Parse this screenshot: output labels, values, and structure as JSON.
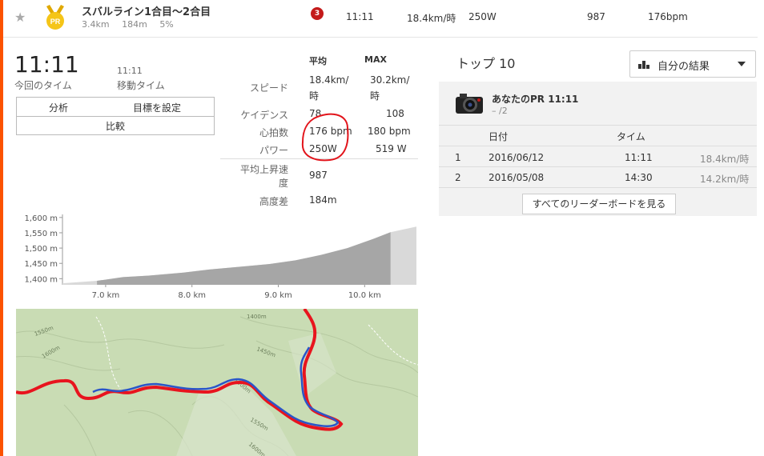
{
  "segment": {
    "title": "スバルライン1合目～2合目",
    "distance": "3.4km",
    "elevation": "184m",
    "grade": "5%",
    "medal_text": "PR",
    "rank_badge": "3",
    "time": "11:11",
    "speed": "18.4km/時",
    "power": "250W",
    "vam": "987",
    "heartrate": "176bpm"
  },
  "summary": {
    "elapsed_time": "11:11",
    "elapsed_label": "今回のタイム",
    "moving_time": "11:11",
    "moving_label": "移動タイム"
  },
  "buttons": {
    "analysis": "分析",
    "set_goal": "目標を設定",
    "compare": "比較"
  },
  "stats": {
    "col_avg": "平均",
    "col_max": "MAX",
    "speed_label": "スピード",
    "speed_avg_1": "18.4km/",
    "speed_avg_2": "時",
    "speed_max_1": "30.2km/",
    "speed_max_2": "時",
    "cadence_label": "ケイデンス",
    "cadence_avg": "78",
    "cadence_max": "108",
    "hr_label": "心拍数",
    "hr_avg": "176 bpm",
    "hr_max": "180 bpm",
    "power_label": "パワー",
    "power_avg": "250W",
    "power_max": "519 W",
    "vam_label_1": "平均上昇速",
    "vam_label_2": "度",
    "vam_value": "987",
    "elev_label": "高度差",
    "elev_value": "184m"
  },
  "chart_data": {
    "type": "area",
    "y_ticks": [
      "1,600 m",
      "1,550 m",
      "1,500 m",
      "1,450 m",
      "1,400 m"
    ],
    "x_ticks": [
      "7.0 km",
      "8.0 km",
      "9.0 km",
      "10.0 km"
    ],
    "x": [
      6.5,
      6.9,
      7.2,
      7.5,
      7.9,
      8.2,
      8.6,
      8.9,
      9.2,
      9.5,
      9.8,
      10.1,
      10.3,
      10.6
    ],
    "y": [
      1385,
      1393,
      1405,
      1410,
      1420,
      1430,
      1440,
      1448,
      1460,
      1478,
      1500,
      1530,
      1552,
      1570
    ],
    "segment_range": [
      6.9,
      10.3
    ],
    "xlim": [
      6.5,
      10.6
    ],
    "ylim": [
      1380,
      1610
    ]
  },
  "map": {
    "contour_labels": [
      "1550m",
      "1600m",
      "1400m",
      "1450m",
      "1500m",
      "1550m",
      "1600m"
    ]
  },
  "leaderboard": {
    "title": "トップ 10",
    "filter_label": "自分の結果",
    "pr_title": "あなたのPR 11:11",
    "pr_rank": "– /2",
    "col_date": "日付",
    "col_time": "タイム",
    "rows": [
      {
        "rank": "1",
        "date": "2016/06/12",
        "time": "11:11",
        "speed": "18.4km/時"
      },
      {
        "rank": "2",
        "date": "2016/05/08",
        "time": "14:30",
        "speed": "14.2km/時"
      }
    ],
    "view_all": "すべてのリーダーボードを見る"
  },
  "colors": {
    "accent": "#fc5200",
    "route_red": "#e8141e",
    "route_blue": "#2a55c8",
    "annotation_red": "#e2141b"
  }
}
